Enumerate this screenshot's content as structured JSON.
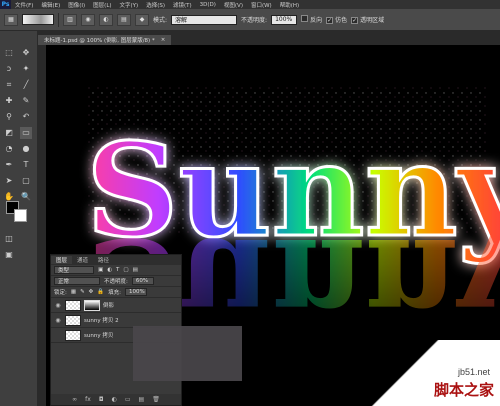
{
  "app": {
    "logo": "Ps"
  },
  "menu": [
    "文件(F)",
    "编辑(E)",
    "图像(I)",
    "图层(L)",
    "文字(Y)",
    "选择(S)",
    "滤镜(T)",
    "3D(D)",
    "视图(V)",
    "窗口(W)",
    "帮助(H)"
  ],
  "options": {
    "mode_label": "模式:",
    "mode_value": "溶解",
    "opacity_label": "不透明度:",
    "opacity_value": "100%",
    "reverse_label": "反向",
    "dither_label": "仿色",
    "transparency_label": "透明区域"
  },
  "document": {
    "tab_title": "未标题-1.psd @ 100% (倒影, 图层蒙版/8) *"
  },
  "artwork": {
    "text": "Sunny"
  },
  "layers_panel": {
    "tabs": [
      "图层",
      "通道",
      "路径"
    ],
    "filter_kind": "类型",
    "blend_mode": "正常",
    "opacity_label": "不透明度:",
    "opacity_value": "60%",
    "lock_label": "锁定:",
    "fill_label": "填充:",
    "fill_value": "100%",
    "layers": [
      {
        "name": "倒影"
      },
      {
        "name": "sunny 拷贝 2"
      },
      {
        "name": "sunny 拷贝"
      }
    ]
  },
  "watermark": {
    "url": "jb51.net",
    "name": "脚本之家"
  }
}
